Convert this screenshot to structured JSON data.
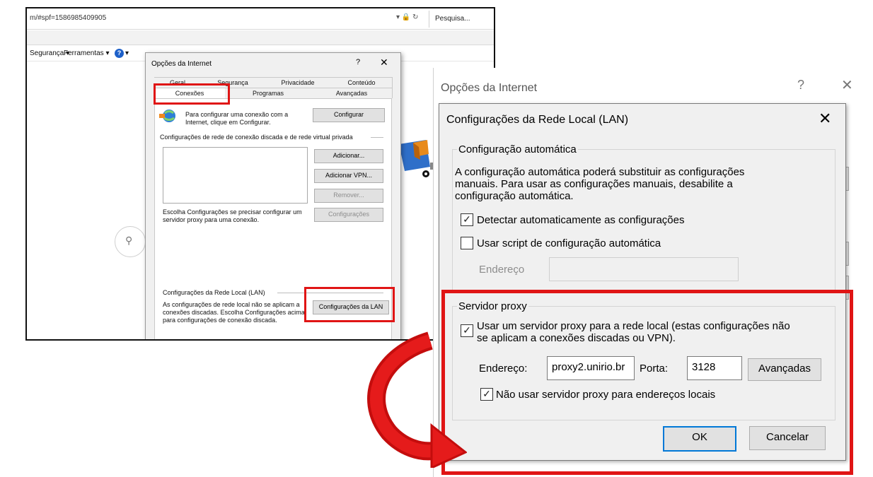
{
  "browser": {
    "url": "m/#spf=1586985409905",
    "search_placeholder": "Pesquisa...",
    "menu_items": [
      "Segurança ▾",
      "Ferramentas ▾"
    ],
    "help_glyph": "?",
    "help_dropdown": "▾",
    "search_glyph": "🔍"
  },
  "small_dialog": {
    "title": "Opções da Internet",
    "help": "?",
    "close": "✕",
    "tabs_row1": [
      "Geral",
      "Segurança",
      "Privacidade",
      "Conteúdo"
    ],
    "tabs_row2": [
      "Conexões",
      "Programas",
      "Avançadas"
    ],
    "setup_text": "Para configurar uma conexão com a Internet, clique em Configurar.",
    "setup_button": "Configurar",
    "dialup_section": "Configurações de rede de conexão discada e de rede virtual privada",
    "add_button": "Adicionar...",
    "add_vpn_button": "Adicionar VPN...",
    "remove_button": "Remover...",
    "choose_text": "Escolha Configurações se precisar configurar um servidor proxy para uma conexão.",
    "settings_button": "Configurações",
    "lan_section": "Configurações da Rede Local (LAN)",
    "lan_text": "As configurações de rede local não se aplicam a conexões discadas. Escolha Configurações acima para configurações de conexão discada.",
    "lan_button": "Configurações da LAN"
  },
  "back_dialog": {
    "title": "Opções da Internet",
    "help": "?",
    "close": "✕"
  },
  "lan_dialog": {
    "title": "Configurações da Rede Local (LAN)",
    "close": "✕",
    "auto_group": "Configuração automática",
    "auto_desc": [
      "A configuração automática poderá substituir as configurações",
      "manuais. Para usar as configurações manuais, desabilite a",
      "configuração automática."
    ],
    "detect_label": "Detectar automaticamente as configurações",
    "detect_checked": true,
    "script_label": "Usar script de configuração automática",
    "script_checked": false,
    "address_label": "Endereço",
    "address_value": "",
    "proxy_group": "Servidor proxy",
    "use_proxy_label": [
      "Usar um servidor proxy para a rede local (estas configurações não",
      "se aplicam a conexões discadas ou VPN)."
    ],
    "use_proxy_checked": true,
    "proxy_address_label": "Endereço:",
    "proxy_address_value": "proxy2.unirio.br",
    "port_label": "Porta:",
    "port_value": "3128",
    "advanced_button": "Avançadas",
    "bypass_label": "Não usar servidor proxy para endereços locais",
    "bypass_checked": true,
    "ok_button": "OK",
    "cancel_button": "Cancelar",
    "check_glyph": "✓"
  },
  "colors": {
    "highlight": "#e01515",
    "focus": "#0078d7"
  }
}
